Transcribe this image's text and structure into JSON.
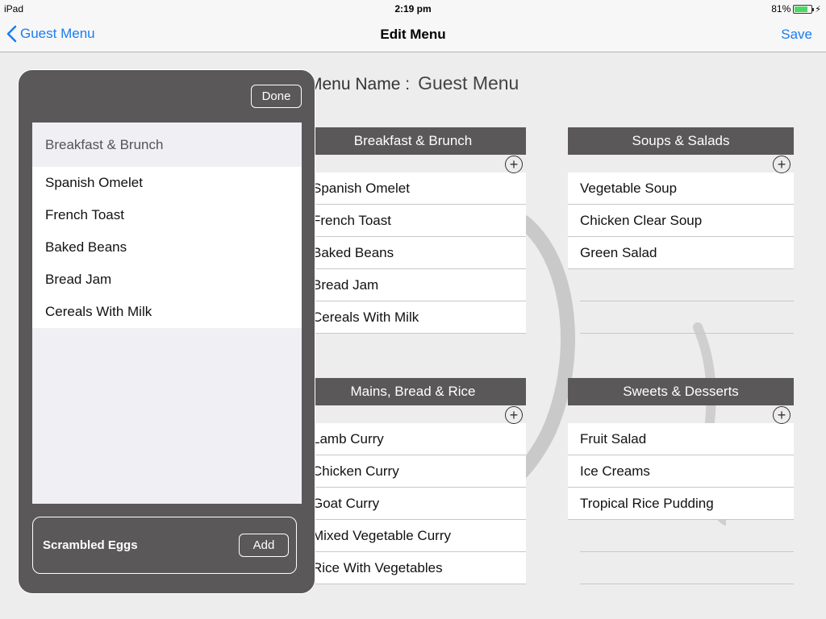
{
  "status_bar": {
    "carrier": "iPad",
    "time": "2:19 pm",
    "battery": "81%",
    "battery_level": 0.81
  },
  "nav": {
    "back_label": "Guest Menu",
    "title": "Edit Menu",
    "save_label": "Save"
  },
  "menu_name": {
    "label": "Menu Name :",
    "value": "Guest Menu"
  },
  "categories": [
    {
      "title": "Breakfast & Brunch",
      "items": [
        "Spanish Omelet",
        "French Toast",
        "Baked Beans",
        "Bread Jam",
        "Cereals With Milk"
      ]
    },
    {
      "title": "Soups & Salads",
      "items": [
        "Vegetable Soup",
        "Chicken Clear Soup",
        "Green Salad"
      ]
    },
    {
      "title": "Mains, Bread & Rice",
      "items": [
        "Lamb Curry",
        "Chicken Curry",
        "Goat Curry",
        "Mixed Vegetable Curry",
        "Rice With Vegetables"
      ]
    },
    {
      "title": "Sweets & Desserts",
      "items": [
        "Fruit Salad",
        "Ice Creams",
        "Tropical Rice Pudding"
      ]
    }
  ],
  "popover": {
    "done_label": "Done",
    "section_title": "Breakfast & Brunch",
    "items": [
      "Spanish Omelet",
      "French Toast",
      "Baked Beans",
      "Bread Jam",
      "Cereals With Milk"
    ],
    "new_item": "Scrambled Eggs",
    "add_label": "Add"
  },
  "icons": {
    "back": "chevron-left-icon",
    "add": "plus-circle-icon"
  },
  "colors": {
    "accent": "#1a7cf0",
    "header": "#5a5859"
  }
}
